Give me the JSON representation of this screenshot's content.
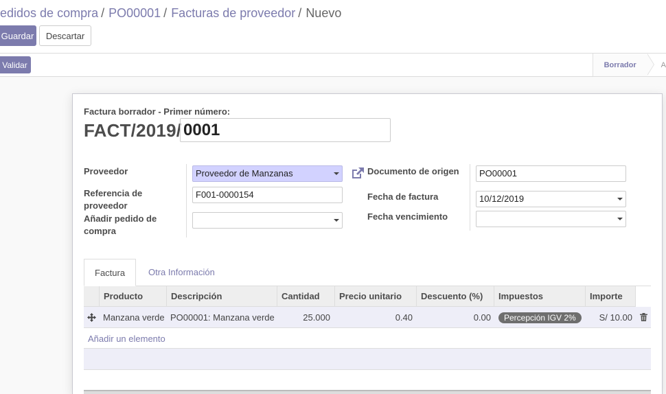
{
  "breadcrumb": {
    "items": [
      "edidos de compra",
      "PO00001",
      "Facturas de proveedor"
    ],
    "active": "Nuevo",
    "separator": "/"
  },
  "buttons": {
    "save": "Guardar",
    "discard": "Descartar",
    "validate": "Validar"
  },
  "statusbar": {
    "current": "Borrador",
    "next_truncated": "A"
  },
  "form": {
    "draft_label": "Factura borrador - Primer número:",
    "number_prefix": "FACT/2019/",
    "number_value": "0001",
    "left": {
      "supplier_label": "Proveedor",
      "supplier_value": "Proveedor de Manzanas",
      "reference_label": "Referencia de proveedor",
      "reference_value": "F001-0000154",
      "add_po_label": "Añadir pedido de compra",
      "add_po_value": ""
    },
    "right": {
      "source_doc_label": "Documento de origen",
      "source_doc_value": "PO00001",
      "invoice_date_label": "Fecha de factura",
      "invoice_date_value": "10/12/2019",
      "due_date_label": "Fecha vencimiento",
      "due_date_value": ""
    }
  },
  "tabs": [
    {
      "label": "Factura",
      "active": true
    },
    {
      "label": "Otra Información",
      "active": false
    }
  ],
  "lines": {
    "columns": [
      "Producto",
      "Descripción",
      "Cantidad",
      "Precio unitario",
      "Descuento (%)",
      "Impuestos",
      "Importe"
    ],
    "rows": [
      {
        "product": "Manzana verde",
        "description": "PO00001: Manzana verde",
        "quantity": "25.000",
        "unit_price": "0.40",
        "discount": "0.00",
        "tax": "Percepción IGV 2%",
        "amount": "S/ 10.00"
      }
    ],
    "add_line": "Añadir un elemento"
  },
  "colors": {
    "brand": "#7c7bad",
    "required_field": "#d2d2ff",
    "tax_badge": "#6e6e6e"
  },
  "icons": {
    "external": "external-link-icon",
    "drag": "drag-handle-icon",
    "delete": "trash-icon"
  }
}
